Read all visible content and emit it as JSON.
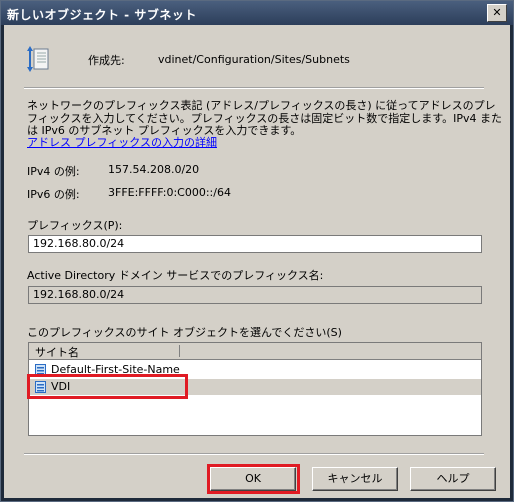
{
  "window": {
    "title": "新しいオブジェクト - サブネット",
    "close_glyph": "✕"
  },
  "header": {
    "create_in_label": "作成先:",
    "create_in_path": "vdinet/Configuration/Sites/Subnets"
  },
  "description": {
    "line1": "ネットワークのプレフィックス表記 (アドレス/プレフィックスの長さ) に従ってアドレスのプレ",
    "line2": "フィックスを入力してください。プレフィックスの長さは固定ビット数で指定します。IPv4 また",
    "line3": "は IPv6 のサブネット プレフィックスを入力できます。",
    "link": "アドレス プレフィックスの入力の詳細"
  },
  "examples": {
    "ipv4_label": "IPv4 の例:",
    "ipv4_value": "157.54.208.0/20",
    "ipv6_label": "IPv6 の例:",
    "ipv6_value": "3FFE:FFFF:0:C000::/64"
  },
  "prefix": {
    "label": "プレフィックス(P):",
    "value": "192.168.80.0/24"
  },
  "ad_name": {
    "label": "Active Directory ドメイン サービスでのプレフィックス名:",
    "value": "192.168.80.0/24"
  },
  "sites": {
    "label": "このプレフィックスのサイト オブジェクトを選んでください(S)",
    "column_header": "サイト名",
    "items": [
      {
        "name": "Default-First-Site-Name",
        "selected": false
      },
      {
        "name": "VDI",
        "selected": true
      }
    ]
  },
  "buttons": {
    "ok": "OK",
    "cancel": "キャンセル",
    "help": "ヘルプ"
  },
  "colors": {
    "highlight": "#e01b24",
    "link": "#0000ff",
    "dialog_bg": "#d4d0c8"
  }
}
